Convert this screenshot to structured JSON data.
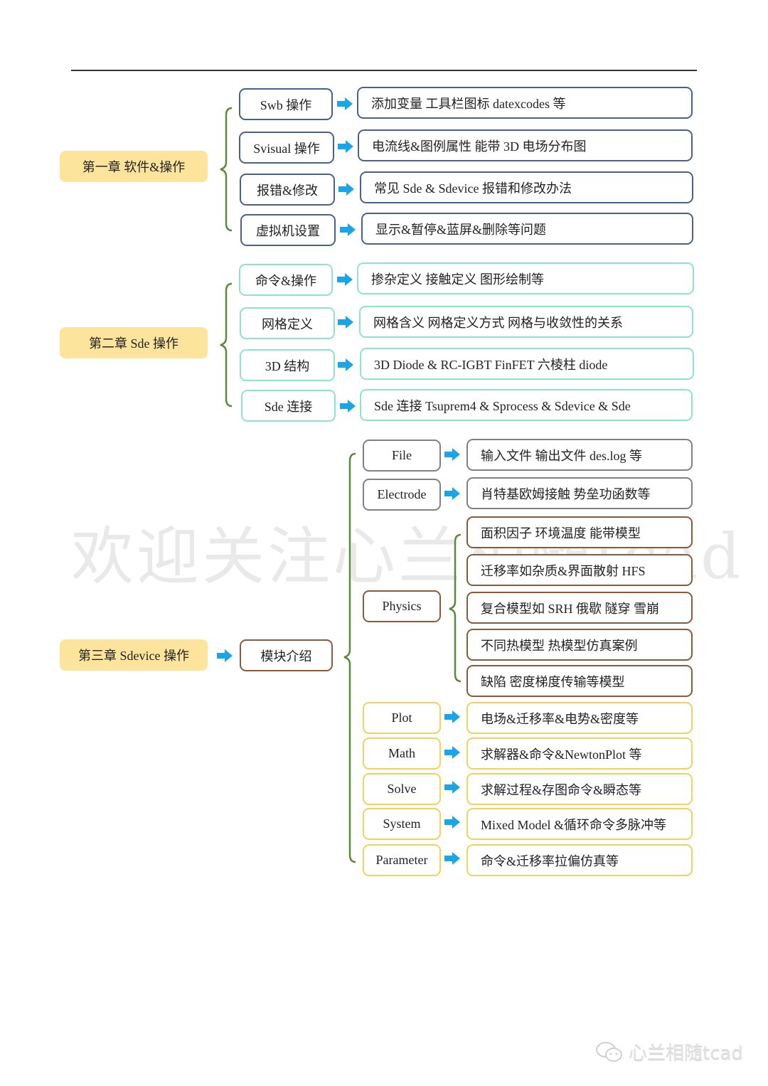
{
  "watermark": "欢迎关注心兰相随tcad",
  "footer": {
    "brand": "心兰相随tcad",
    "icon": "wechat-icon"
  },
  "colors": {
    "chapter_fill": "#fde49c",
    "brace": "#5a8a3c",
    "arrow": "#1aa6e6",
    "chapter1_border": "#4a6288",
    "chapter2_border": "#8de3cf",
    "file_border": "#808080",
    "physics_border": "#8a5a3a",
    "tail_border": "#f2d15d"
  },
  "chapters": [
    {
      "title": "第一章  软件&操作",
      "items": [
        {
          "label": "Swb 操作",
          "detail": "添加变量  工具栏图标  datexcodes 等"
        },
        {
          "label": "Svisual 操作",
          "detail": "电流线&图例属性  能带  3D 电场分布图"
        },
        {
          "label": "报错&修改",
          "detail": "常见 Sde & Sdevice 报错和修改办法"
        },
        {
          "label": "虚拟机设置",
          "detail": "显示&暂停&蓝屏&删除等问题"
        }
      ]
    },
    {
      "title": "第二章  Sde 操作",
      "items": [
        {
          "label": "命令&操作",
          "detail": "掺杂定义  接触定义  图形绘制等"
        },
        {
          "label": "网格定义",
          "detail": "网格含义  网格定义方式  网格与收敛性的关系"
        },
        {
          "label": "3D 结构",
          "detail": "3D Diode & RC-IGBT FinFET  六棱柱 diode"
        },
        {
          "label": "Sde 连接",
          "detail": "Sde 连接 Tsuprem4 & Sprocess & Sdevice & Sde"
        }
      ]
    },
    {
      "title": "第三章  Sdevice 操作",
      "module": "模块介绍",
      "items": [
        {
          "label": "File",
          "detail": "输入文件  输出文件 des.log 等"
        },
        {
          "label": "Electrode",
          "detail": "肖特基欧姆接触  势垒功函数等"
        },
        {
          "label": "Physics",
          "details": [
            "面积因子  环境温度  能带模型",
            "迁移率如杂质&界面散射  HFS",
            "复合模型如 SRH  俄歇  隧穿  雪崩",
            "不同热模型  热模型仿真案例",
            "缺陷  密度梯度传输等模型"
          ]
        },
        {
          "label": "Plot",
          "detail": "电场&迁移率&电势&密度等"
        },
        {
          "label": "Math",
          "detail": "求解器&命令&NewtonPlot 等"
        },
        {
          "label": "Solve",
          "detail": "求解过程&存图命令&瞬态等"
        },
        {
          "label": "System",
          "detail": "Mixed Model &循环命令多脉冲等"
        },
        {
          "label": "Parameter",
          "detail": "命令&迁移率拉偏仿真等"
        }
      ]
    }
  ]
}
